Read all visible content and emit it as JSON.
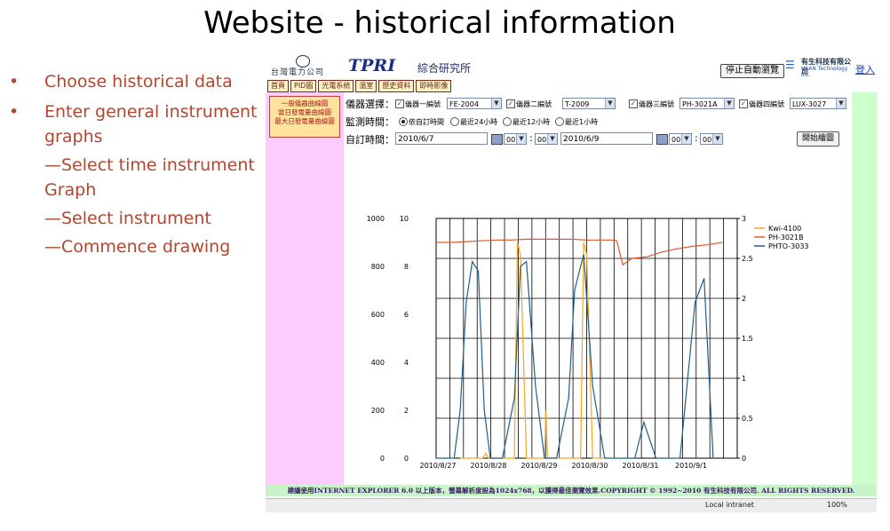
{
  "slide": {
    "title": "Website - historical information",
    "bullets": [
      {
        "text": "Choose  historical data"
      },
      {
        "text": "Enter general instrument graphs"
      }
    ],
    "subitems": [
      "—Select time instrument Graph",
      "—Select instrument",
      "—Commence drawing"
    ]
  },
  "header": {
    "logo_text": "台灣電力公司",
    "brand": "TPRI",
    "institute": "綜合研究所",
    "stop_button": "停止自動瀏覽",
    "company_cn": "有生科技有限公司",
    "company_en": "USAN Technology Inc.",
    "login": "登入"
  },
  "nav": [
    "首頁",
    "PID圖",
    "光電系統",
    "溫室",
    "歷史資料",
    "即時影像"
  ],
  "sidemenu": [
    "一般儀器曲線圖",
    "當日發電量曲線圖",
    "最大日發電量曲線圖"
  ],
  "form": {
    "instrument_label": "儀器選擇：",
    "instruments": [
      {
        "label": "儀器一編號",
        "value": "FE-2004"
      },
      {
        "label": "儀器二編號",
        "value": "T-2009"
      },
      {
        "label": "儀器三編號",
        "value": "PH-3021A"
      },
      {
        "label": "儀器四編號",
        "value": "LUX-3027"
      }
    ],
    "monitor_label": "監測時間：",
    "monitor_options": [
      "依自訂時間",
      "最近24小時",
      "最近12小時",
      "最近1小時"
    ],
    "custom_label": "自訂時間：",
    "start_date": "2010/6/7",
    "end_date": "2010/6/9",
    "start_hour": "00",
    "start_min": "00",
    "end_hour": "00",
    "end_min": "00",
    "colon": ":",
    "draw_button": "開始繪圖"
  },
  "footer": "建議使用INTERNET EXPLORER 6.0 以上版本，螢幕解析度設為1024x768，以獲得最佳瀏覽效果.COPYRIGHT © 1992~2010 有生科技有限公司. ALL RIGHTS RESERVED.",
  "statusbar": {
    "zone": "Local intranet",
    "zoom": "100%"
  },
  "colors": {
    "bullet": "#b2462e",
    "left_pane": "#ffccff",
    "right_pane": "#ccffcc",
    "series_kwi": "#f5a623",
    "series_ph": "#e0582a",
    "series_phto": "#1f5f8b"
  },
  "chart_data": {
    "type": "line",
    "x_tick_labels": [
      "2010/8/27",
      "2010/8/28",
      "2010/8/29",
      "2010/8/30",
      "2010/8/31",
      "2010/9/1"
    ],
    "y_axes": [
      {
        "ticks": [
          "1000",
          "800",
          "600",
          "400",
          "200",
          "0"
        ],
        "ylim": [
          0,
          1000
        ]
      },
      {
        "ticks": [
          "10",
          "8",
          "6",
          "4",
          "2",
          "0"
        ],
        "ylim": [
          0,
          10
        ]
      },
      {
        "ticks": [
          "3",
          "2.5",
          "2",
          "1.5",
          "1",
          "0.5",
          "0"
        ],
        "ylim": [
          0,
          3
        ]
      }
    ],
    "grid": true,
    "legend_position": "right",
    "series": [
      {
        "name": "Kwi-4100",
        "axis": "left",
        "x": [
          0.8,
          1.0,
          1.2,
          1.4,
          1.55,
          1.65,
          1.75,
          1.8,
          1.9,
          2.0,
          2.2,
          2.4,
          2.5,
          2.6,
          2.7,
          2.8,
          3.0,
          3.2,
          3.4,
          3.5,
          3.6,
          3.65,
          3.7,
          3.8,
          3.9,
          4.0,
          4.1,
          4.3,
          4.5,
          4.7,
          4.8,
          4.9,
          5.0,
          5.2,
          5.4,
          5.5,
          5.6
        ],
        "y": [
          0,
          0,
          0,
          0,
          0,
          20,
          0,
          0,
          0,
          0,
          0,
          0,
          0,
          0,
          900,
          850,
          0,
          0,
          0,
          0,
          0,
          200,
          0,
          0,
          0,
          0,
          0,
          0,
          0,
          0,
          0,
          900,
          850,
          0,
          0,
          0,
          0
        ]
      },
      {
        "name": "PH-3021B",
        "axis": "right",
        "x": [
          0,
          0.5,
          1.0,
          1.5,
          2.0,
          2.5,
          3.0,
          3.5,
          4.0,
          4.5,
          5.0,
          5.5,
          5.8,
          6.0,
          6.2,
          6.5,
          7.0,
          7.5,
          8.0,
          8.5,
          9.0,
          9.5
        ],
        "y": [
          2.7,
          2.7,
          2.71,
          2.72,
          2.73,
          2.73,
          2.74,
          2.74,
          2.74,
          2.74,
          2.73,
          2.73,
          2.73,
          2.72,
          2.42,
          2.5,
          2.52,
          2.58,
          2.62,
          2.65,
          2.67,
          2.7
        ]
      },
      {
        "name": "PHTO-3033",
        "axis": "left",
        "x": [
          0,
          0.6,
          0.8,
          1.0,
          1.2,
          1.4,
          1.6,
          1.8,
          2.2,
          2.6,
          2.8,
          3.0,
          3.3,
          3.6,
          4.0,
          4.4,
          4.6,
          4.9,
          5.2,
          5.6,
          6.0,
          6.6,
          6.9,
          7.3,
          7.7,
          8.1,
          8.6,
          8.9,
          9.2
        ],
        "y": [
          0,
          0,
          200,
          650,
          820,
          780,
          200,
          0,
          0,
          250,
          800,
          820,
          300,
          0,
          0,
          250,
          700,
          850,
          300,
          0,
          0,
          0,
          150,
          0,
          0,
          0,
          650,
          750,
          0
        ]
      }
    ]
  }
}
